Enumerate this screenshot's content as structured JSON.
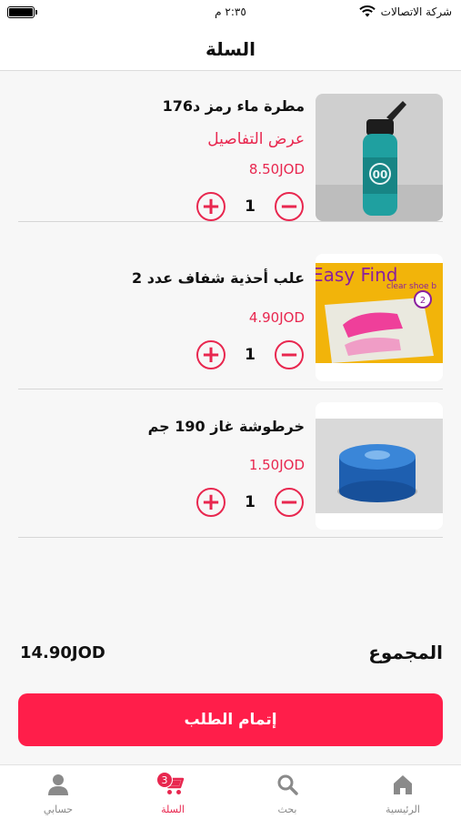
{
  "status": {
    "carrier": "شركة الاتصالات",
    "time": "٢:٣٥ م"
  },
  "header": {
    "title": "السلة"
  },
  "cart": {
    "items": [
      {
        "name": "مطرة ماء رمز د176",
        "details_link": "عرض التفاصيل",
        "price": "8.50JOD",
        "quantity": "1",
        "image": "water-bottle"
      },
      {
        "name": "علب أحذية شفاف عدد 2",
        "price": "4.90JOD",
        "quantity": "1",
        "image": "clear-shoe-box",
        "image_text": "Easy Find",
        "image_subtext": "clear shoe b"
      },
      {
        "name": "خرطوشة غاز 190 جم",
        "price": "1.50JOD",
        "quantity": "1",
        "image": "gas-cartridge"
      }
    ],
    "total_label": "المجموع",
    "total_value": "14.90JOD",
    "checkout_label": "إتمام الطلب"
  },
  "tabbar": {
    "tabs": [
      {
        "label": "الرئيسية",
        "icon": "home-icon"
      },
      {
        "label": "بحث",
        "icon": "search-icon"
      },
      {
        "label": "السلة",
        "icon": "cart-icon",
        "badge": "3",
        "active": true
      },
      {
        "label": "حسابي",
        "icon": "user-icon"
      }
    ]
  },
  "colors": {
    "accent": "#e8274f",
    "button": "#ff1e4a"
  }
}
